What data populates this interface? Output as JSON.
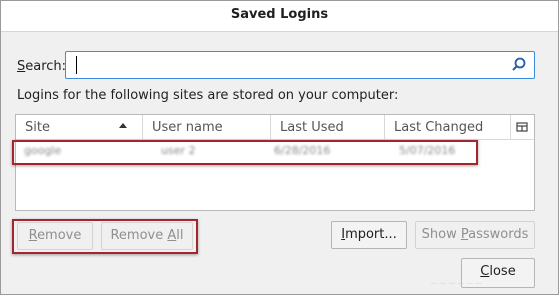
{
  "window": {
    "title": "Saved Logins"
  },
  "search": {
    "label": "Search:",
    "value": "",
    "placeholder": ""
  },
  "info_text": "Logins for the following sites are stored on your computer:",
  "table": {
    "columns": [
      "Site",
      "User name",
      "Last Used",
      "Last Changed"
    ],
    "sorted_by": "Site",
    "rows": [
      {
        "site": "google",
        "user": "user 2",
        "last_used": "6/28/2016",
        "last_changed": "5/07/2016"
      }
    ]
  },
  "buttons": {
    "remove": "Remove",
    "remove_all": "Remove All",
    "import": "Import...",
    "show_passwords": "Show Passwords",
    "close": "Close"
  },
  "colors": {
    "highlight": "#a4262c",
    "focus": "#3b8be0"
  }
}
